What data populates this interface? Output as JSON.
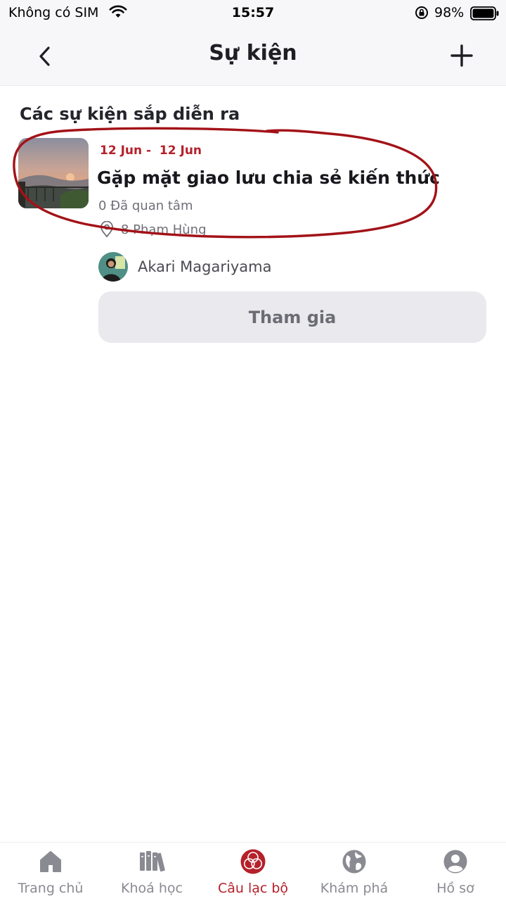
{
  "status_bar": {
    "carrier": "Không có SIM",
    "time": "15:57",
    "battery": "98%"
  },
  "header": {
    "title": "Sự kiện",
    "back_icon": "chevron-left-icon",
    "add_icon": "plus-icon"
  },
  "section": {
    "title": "Các sự kiện sắp diễn ra"
  },
  "event": {
    "date_range": "12 Jun -  12 Jun",
    "title": "Gặp mặt giao lưu chia sẻ kiến thức",
    "interested": "0 Đã quan tâm",
    "location": "8 Phạm Hùng",
    "organizer": "Akari Magariyama",
    "join_label": "Tham gia"
  },
  "nav": {
    "items": [
      {
        "label": "Trang chủ",
        "icon": "home-icon"
      },
      {
        "label": "Khoá học",
        "icon": "books-icon"
      },
      {
        "label": "Câu lạc bộ",
        "icon": "club-icon"
      },
      {
        "label": "Khám phá",
        "icon": "globe-icon"
      },
      {
        "label": "Hồ sơ",
        "icon": "profile-icon"
      }
    ],
    "active_index": 2
  },
  "colors": {
    "accent": "#b5202b",
    "inactive": "#8a8a92",
    "annotation": "#a31218"
  }
}
